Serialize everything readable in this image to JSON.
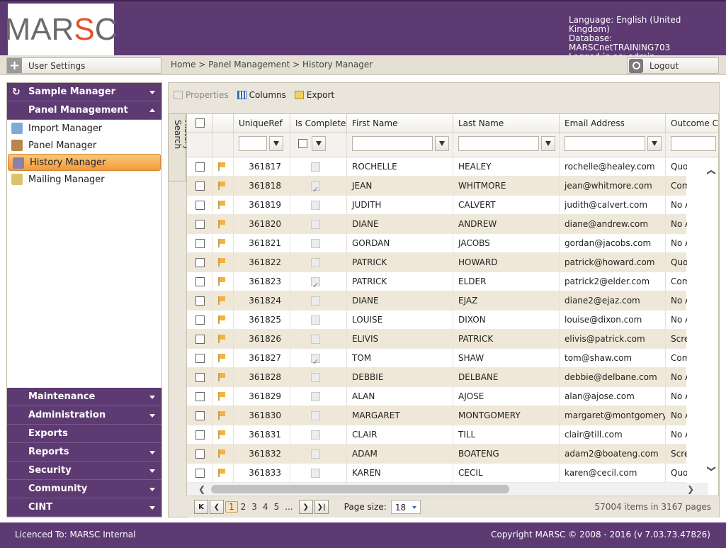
{
  "logo": {
    "text_a": "MAR",
    "text_b": "S",
    "text_c": "C"
  },
  "header": {
    "language": "Language: English (United Kingdom)",
    "database": "Database: MARSCnetTRAINING703",
    "logged_in": "Logged in as: admin"
  },
  "topbar": {
    "user_settings": "User Settings",
    "breadcrumb": "Home > Panel Management > History Manager",
    "logout": "Logout"
  },
  "sidebar": {
    "sample_manager": "Sample Manager",
    "panel_management": "Panel Management",
    "items": [
      {
        "label": "Import Manager",
        "icon": "import-icon",
        "color": "#7fa9d8"
      },
      {
        "label": "Panel Manager",
        "icon": "panel-users-icon",
        "color": "#b8864a"
      },
      {
        "label": "History Manager",
        "icon": "history-icon",
        "color": "#8a7fb0"
      },
      {
        "label": "Mailing Manager",
        "icon": "mailing-icon",
        "color": "#d9c46a"
      }
    ],
    "bottom": [
      {
        "label": "Maintenance",
        "arrow": true
      },
      {
        "label": "Administration",
        "arrow": true
      },
      {
        "label": "Exports",
        "arrow": false
      },
      {
        "label": "Reports",
        "arrow": true
      },
      {
        "label": "Security",
        "arrow": true
      },
      {
        "label": "Community",
        "arrow": true
      },
      {
        "label": "CINT",
        "arrow": true
      }
    ]
  },
  "toolbar": {
    "properties": "Properties",
    "columns": "Columns",
    "export": "Export"
  },
  "history_search": "History Search",
  "grid": {
    "columns": [
      "UniqueRef",
      "Is Complete",
      "First Name",
      "Last Name",
      "Email Address",
      "Outcome Co"
    ],
    "rows": [
      {
        "ref": "361817",
        "complete": false,
        "first": "ROCHELLE",
        "last": "HEALEY",
        "email": "rochelle@healey.com",
        "outcome": "Quota Fu"
      },
      {
        "ref": "361818",
        "complete": true,
        "first": "JEAN",
        "last": "WHITMORE",
        "email": "jean@whitmore.com",
        "outcome": "Complete"
      },
      {
        "ref": "361819",
        "complete": false,
        "first": "JUDITH",
        "last": "CALVERT",
        "email": "judith@calvert.com",
        "outcome": "No Answ"
      },
      {
        "ref": "361820",
        "complete": false,
        "first": "DIANE",
        "last": "ANDREW",
        "email": "diane@andrew.com",
        "outcome": "No Answ"
      },
      {
        "ref": "361821",
        "complete": false,
        "first": "GORDAN",
        "last": "JACOBS",
        "email": "gordan@jacobs.com",
        "outcome": "No Answ"
      },
      {
        "ref": "361822",
        "complete": false,
        "first": "PATRICK",
        "last": "HOWARD",
        "email": "patrick@howard.com",
        "outcome": "Quota Fu"
      },
      {
        "ref": "361823",
        "complete": true,
        "first": "PATRICK",
        "last": "ELDER",
        "email": "patrick2@elder.com",
        "outcome": "Complete"
      },
      {
        "ref": "361824",
        "complete": false,
        "first": "DIANE",
        "last": "EJAZ",
        "email": "diane2@ejaz.com",
        "outcome": "No Answ"
      },
      {
        "ref": "361825",
        "complete": false,
        "first": "LOUISE",
        "last": "DIXON",
        "email": "louise@dixon.com",
        "outcome": "No Answ"
      },
      {
        "ref": "361826",
        "complete": false,
        "first": "ELIVIS",
        "last": "PATRICK",
        "email": "elivis@patrick.com",
        "outcome": "Screened"
      },
      {
        "ref": "361827",
        "complete": true,
        "first": "TOM",
        "last": "SHAW",
        "email": "tom@shaw.com",
        "outcome": "Complete"
      },
      {
        "ref": "361828",
        "complete": false,
        "first": "DEBBIE",
        "last": "DELBANE",
        "email": "debbie@delbane.com",
        "outcome": "No Answ"
      },
      {
        "ref": "361829",
        "complete": false,
        "first": "ALAN",
        "last": "AJOSE",
        "email": "alan@ajose.com",
        "outcome": "No Answ"
      },
      {
        "ref": "361830",
        "complete": false,
        "first": "MARGARET",
        "last": "MONTGOMERY",
        "email": "margaret@montgomery.c",
        "outcome": "No Answ"
      },
      {
        "ref": "361831",
        "complete": false,
        "first": "CLAIR",
        "last": "TILL",
        "email": "clair@till.com",
        "outcome": "No Answ"
      },
      {
        "ref": "361832",
        "complete": false,
        "first": "ADAM",
        "last": "BOATENG",
        "email": "adam2@boateng.com",
        "outcome": "Screened"
      },
      {
        "ref": "361833",
        "complete": false,
        "first": "KAREN",
        "last": "CECIL",
        "email": "karen@cecil.com",
        "outcome": "Quota Fu"
      }
    ]
  },
  "pager": {
    "pages": [
      "1",
      "2",
      "3",
      "4",
      "5",
      "..."
    ],
    "current": "1",
    "page_size_label": "Page size:",
    "page_size": "18",
    "summary": "57004 items in 3167 pages"
  },
  "footer": {
    "licence": "Licenced To: MARSC Internal",
    "copyright": "Copyright MARSC © 2008 - 2016  (v 7.03.73.47826)"
  },
  "colors": {
    "brand": "#5d3a72",
    "selected": "#f29a3a",
    "row_alt": "#efe8d8"
  }
}
